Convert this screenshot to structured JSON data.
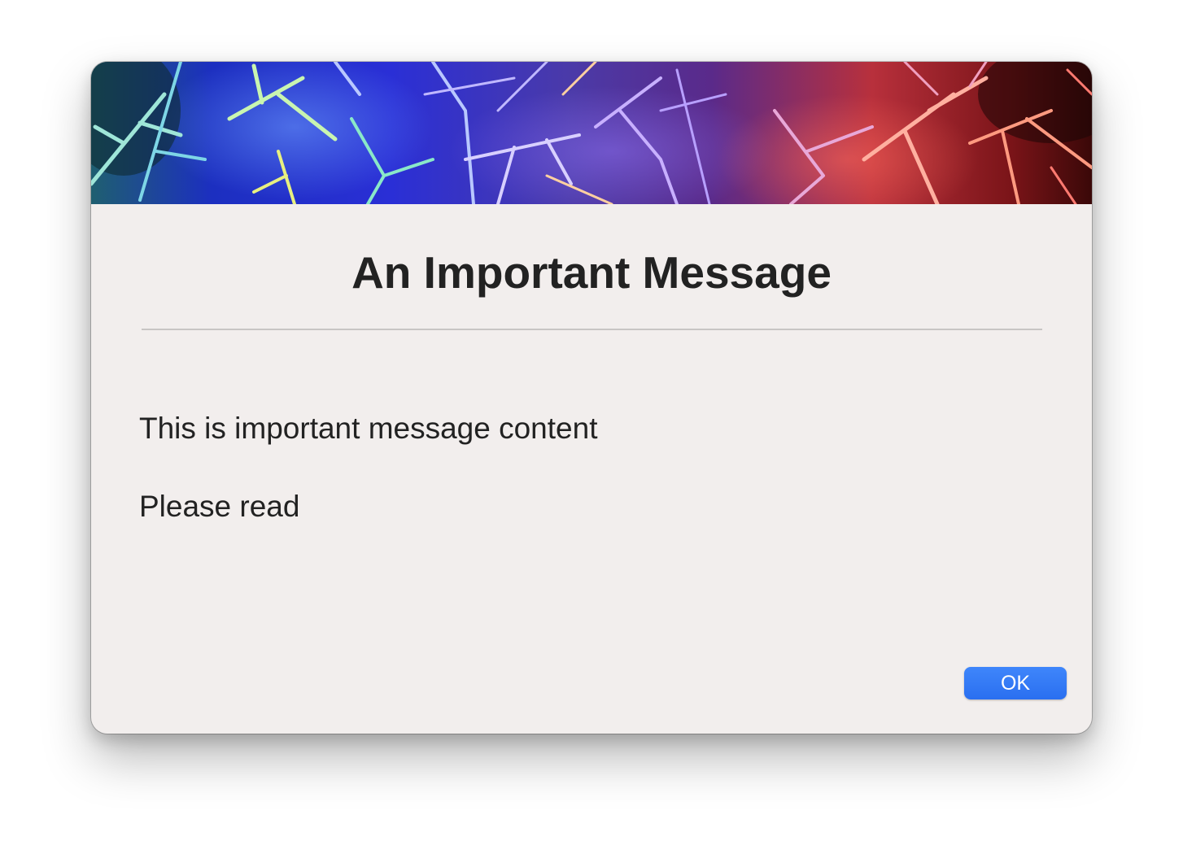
{
  "dialog": {
    "title": "An Important Message",
    "messages": [
      "This is important message content",
      "Please read"
    ],
    "ok_label": "OK"
  },
  "colors": {
    "dialog_background": "#f2eeed",
    "title_text": "#222222",
    "ok_button": "#2f76f5",
    "divider": "#c8c5c4"
  },
  "icons": {
    "banner": "abstract-thorns-banner-image"
  }
}
